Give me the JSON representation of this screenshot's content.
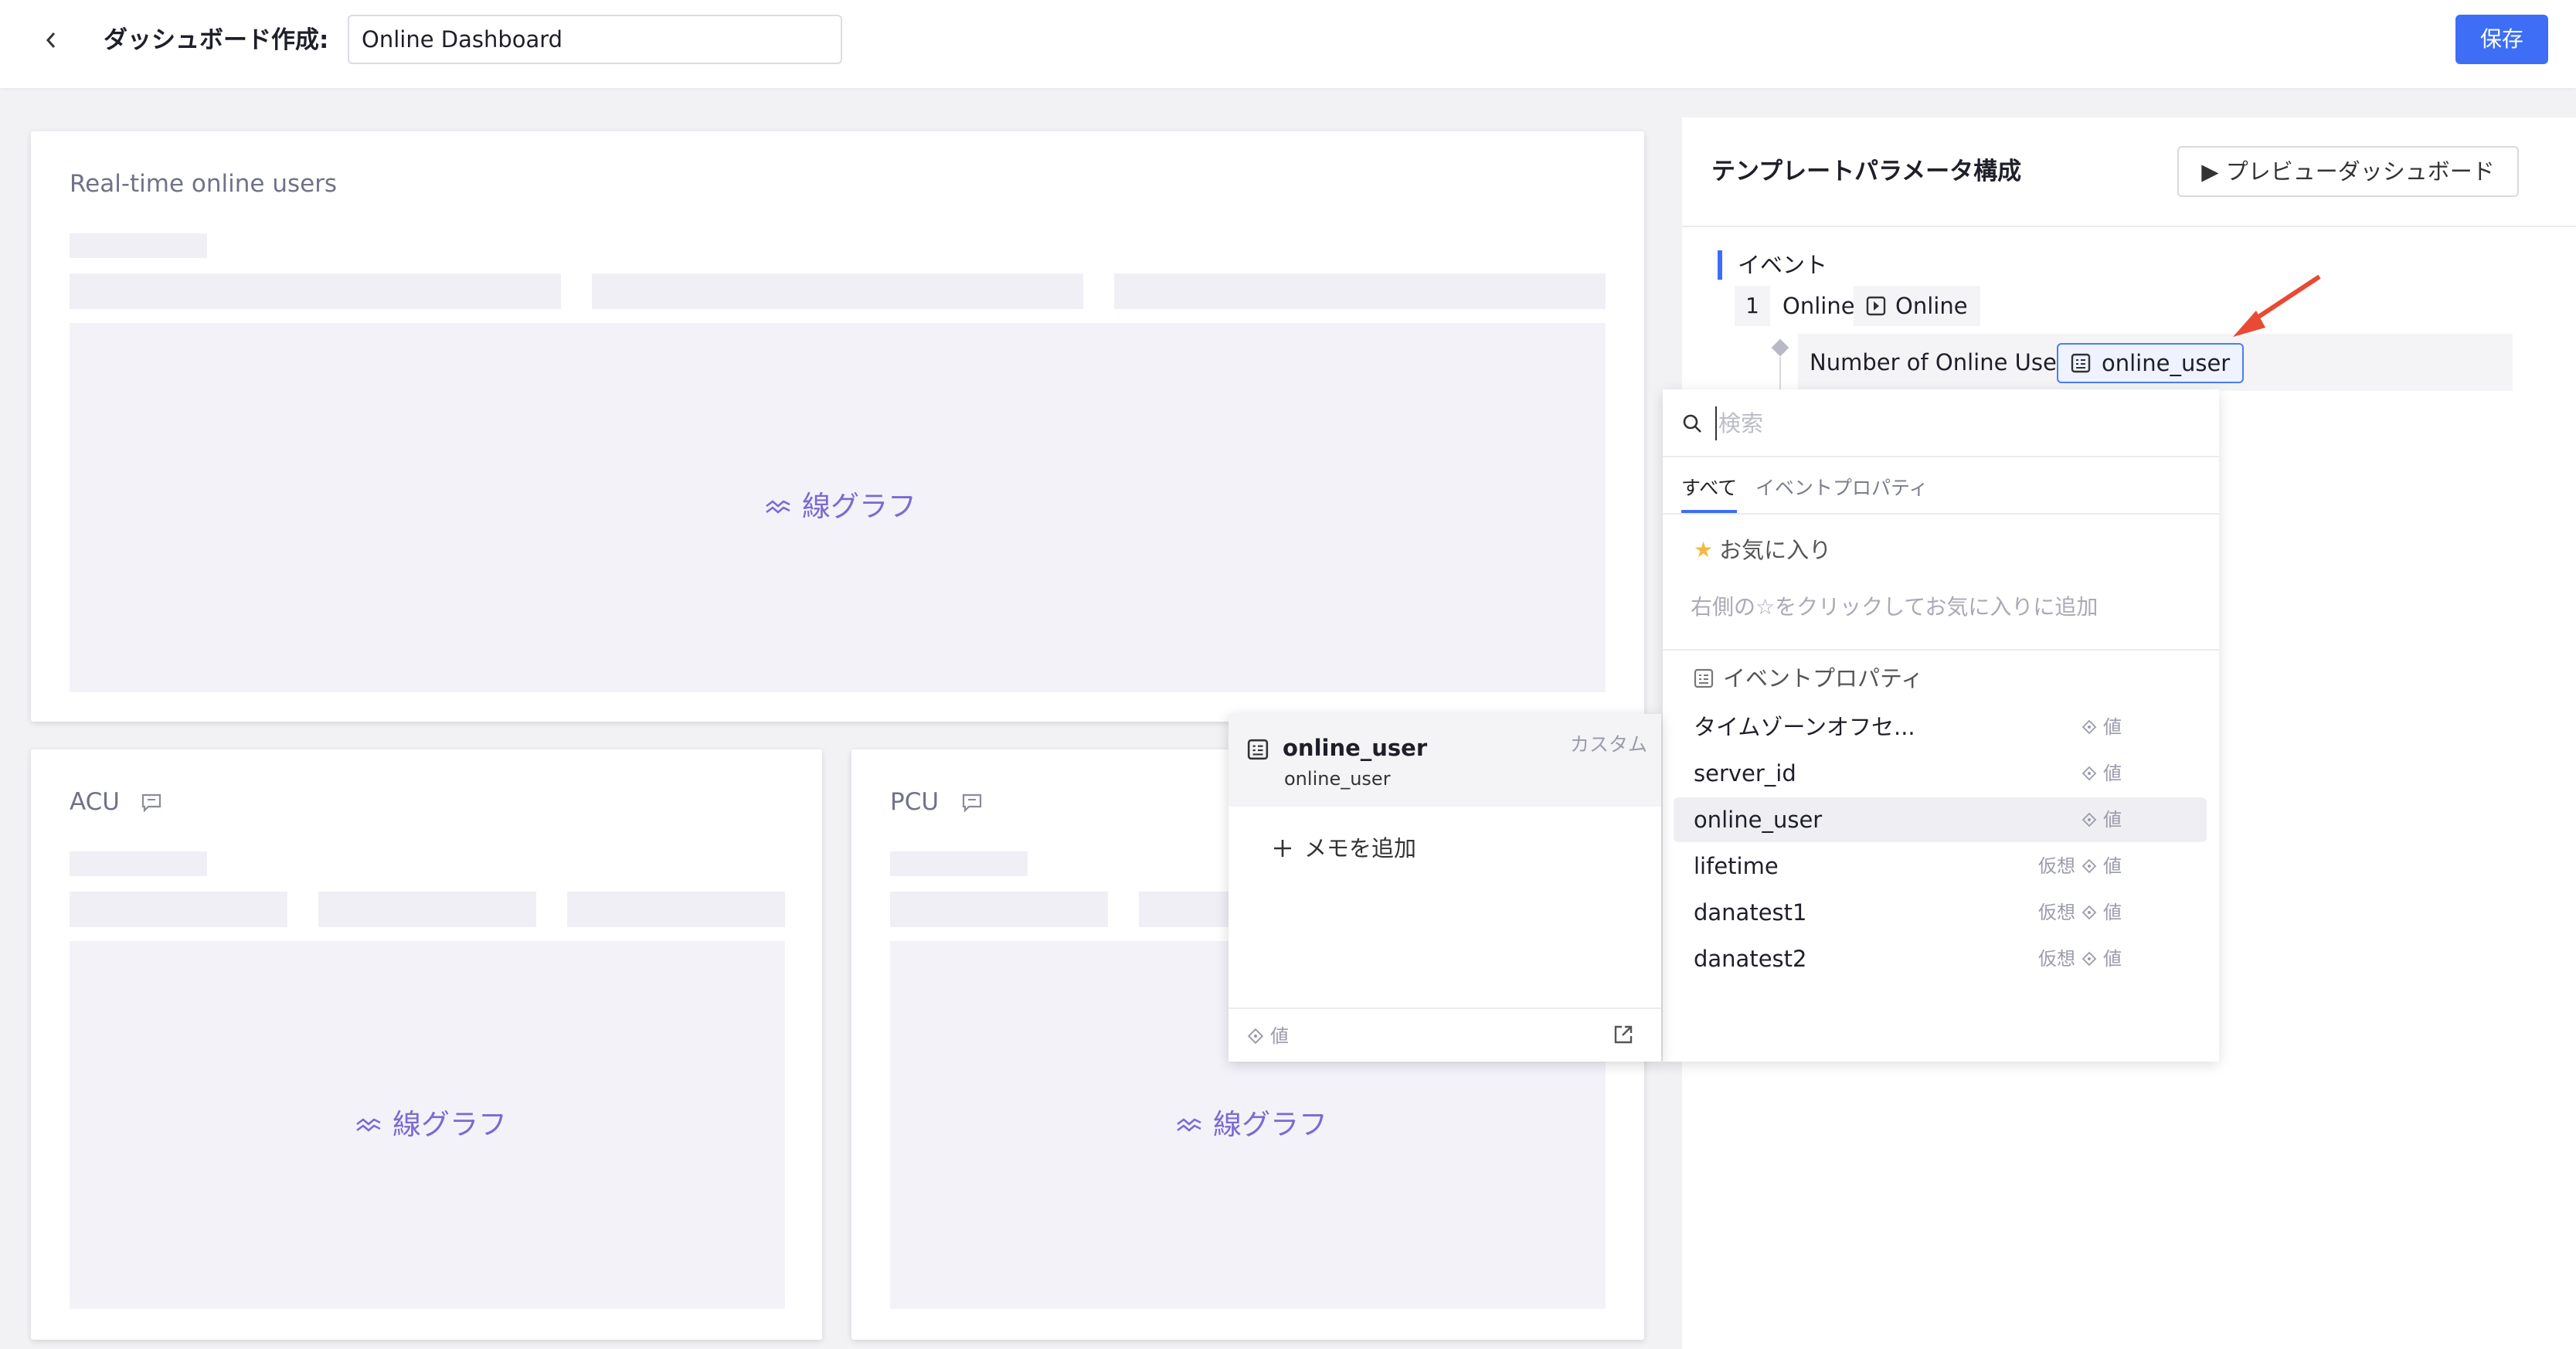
{
  "header": {
    "title": "ダッシュボード作成:",
    "name_value": "Online Dashboard",
    "save_label": "保存"
  },
  "cards": {
    "main": {
      "title": "Real-time online users",
      "chart_label": "線グラフ"
    },
    "acu": {
      "title": "ACU",
      "chart_label": "線グラフ"
    },
    "pcu": {
      "title": "PCU",
      "chart_label": "線グラフ"
    }
  },
  "right_panel": {
    "title": "テンプレートパラメータ構成",
    "preview_label": "プレビューダッシュボード",
    "section_label": "イベント",
    "row_number": "1",
    "event_name": "Online",
    "event_tag": "Online",
    "property_label": "Number of Online Users",
    "property_value": "online_user"
  },
  "dropdown": {
    "search_placeholder": "検索",
    "tabs": {
      "all": "すべて",
      "props": "イベントプロパティ"
    },
    "favorites_label": "お気に入り",
    "favorites_hint": "右側の☆をクリックしてお気に入りに追加",
    "event_props_label": "イベントプロパティ",
    "value_label": "値",
    "items": [
      {
        "name": "タイムゾーンオフセ...",
        "tag": ""
      },
      {
        "name": "server_id",
        "tag": ""
      },
      {
        "name": "online_user",
        "tag": ""
      },
      {
        "name": "lifetime",
        "tag": "仮想"
      },
      {
        "name": "danatest1",
        "tag": "仮想"
      },
      {
        "name": "danatest2",
        "tag": "仮想"
      }
    ]
  },
  "tooltip": {
    "name": "online_user",
    "sub": "online_user",
    "badge": "カスタム",
    "add_memo": "メモを追加",
    "value_label": "値"
  },
  "colors": {
    "accent": "#3d6ef5",
    "chart_label": "#7b6ad3",
    "annotation_arrow": "#e84a33"
  }
}
